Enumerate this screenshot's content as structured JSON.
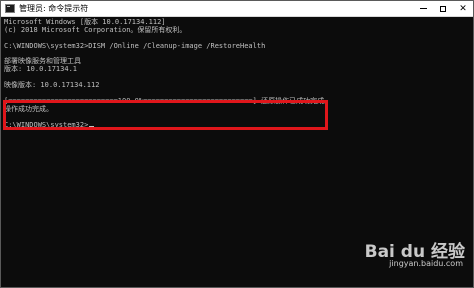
{
  "window": {
    "title": "管理员: 命令提示符",
    "controls": {
      "minimize": "—",
      "maximize": "☐",
      "close": "✕"
    }
  },
  "console": {
    "lines": [
      "Microsoft Windows [版本 10.0.17134.112]",
      "(c) 2018 Microsoft Corporation。保留所有权利。",
      "",
      "C:\\WINDOWS\\system32>DISM /Online /Cleanup-image /RestoreHealth",
      "",
      "部署映像服务和管理工具",
      "版本: 10.0.17134.1",
      "",
      "映像版本: 10.0.17134.112",
      "",
      "[==========================100.0%==========================] 还原操作已成功完成。",
      "操作成功完成。",
      "",
      "C:\\WINDOWS\\system32>"
    ]
  },
  "watermark": {
    "brand": "Bai du 经验",
    "url": "jingyan.baidu.com"
  },
  "colors": {
    "console_bg": "#0c0c0c",
    "console_text": "#c0c0c0",
    "highlight": "#e0161b"
  }
}
